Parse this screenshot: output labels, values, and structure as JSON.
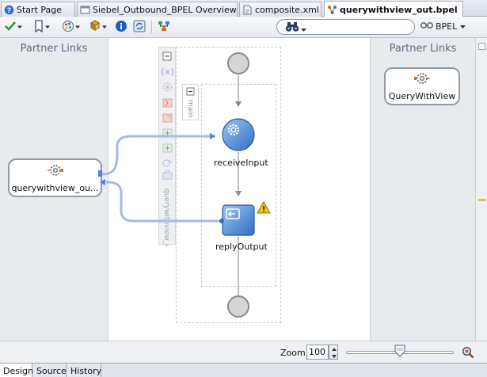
{
  "tabs": [
    {
      "label": "Start Page",
      "active": false
    },
    {
      "label": "Siebel_Outbound_BPEL Overview",
      "active": false
    },
    {
      "label": "composite.xml",
      "active": false
    },
    {
      "label": "querywithview_out.bpel",
      "active": true
    }
  ],
  "toolbar": {
    "search_value": "",
    "bpel_label": "BPEL"
  },
  "canvas": {
    "left_title": "Partner Links",
    "right_title": "Partner Links",
    "left_partner_link": "querywithview_ou...",
    "right_partner_link": "QueryWithView",
    "scope_main_label": "main",
    "scope_vertical_label": "querywithview_out",
    "activities": [
      {
        "name": "receiveInput",
        "type": "receive"
      },
      {
        "name": "replyOutput",
        "type": "reply",
        "warning": true
      }
    ]
  },
  "zoom": {
    "label": "Zoom:",
    "value": "100",
    "level_percent": 50
  },
  "bottom_tabs": [
    {
      "label": "Design",
      "active": true
    },
    {
      "label": "Source",
      "active": false
    },
    {
      "label": "History",
      "active": false
    }
  ],
  "colors": {
    "accent_blue": "#3a7fd0",
    "connector": "#a9b8ea",
    "partner_border": "#8f9aa6",
    "warning": "#f2c21a"
  }
}
